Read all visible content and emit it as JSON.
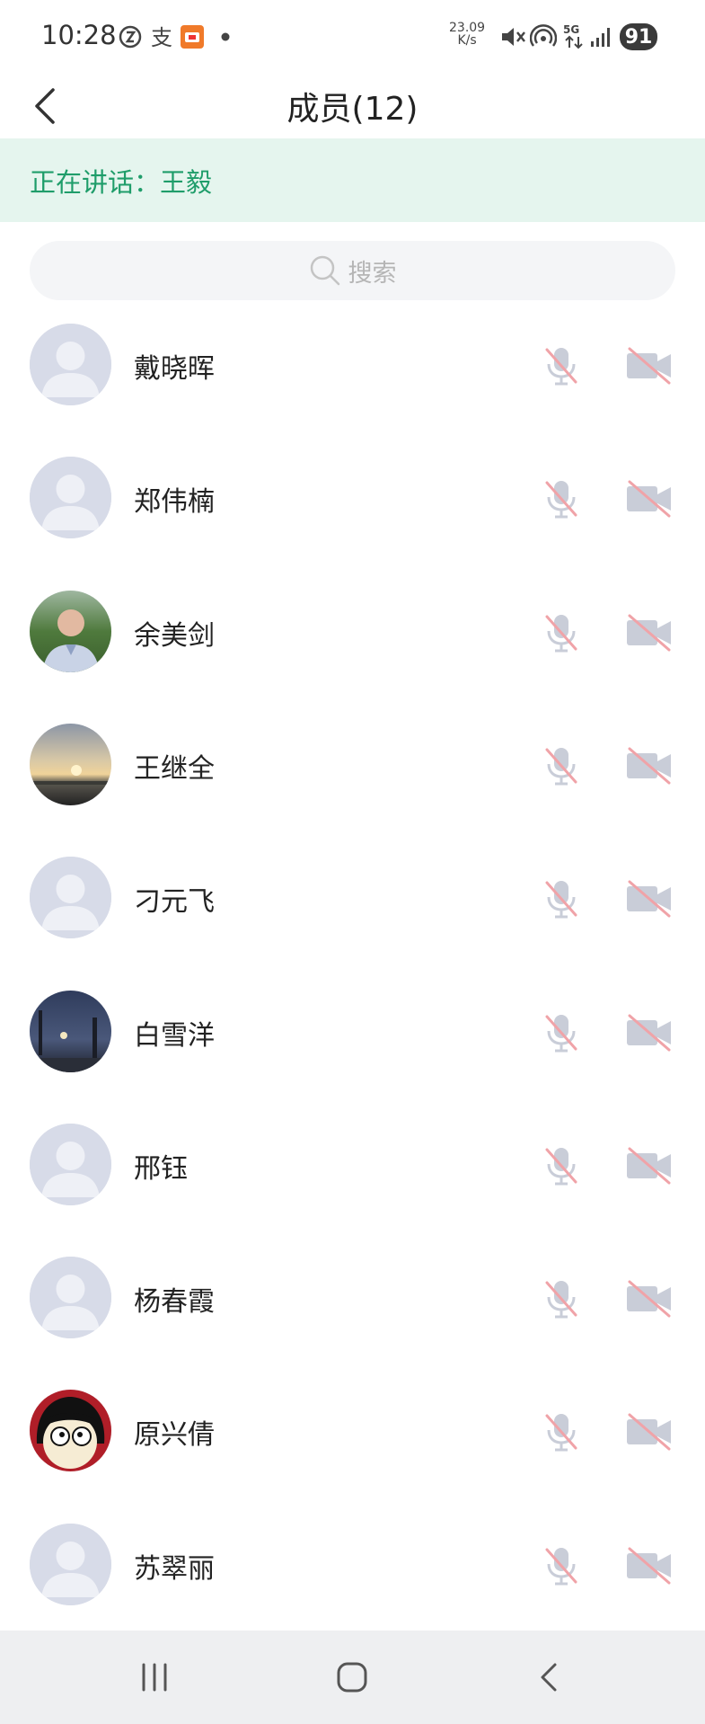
{
  "status": {
    "time": "10:28",
    "net_speed_value": "23.09",
    "net_speed_unit": "K/s",
    "network": "5G",
    "battery": "91"
  },
  "header": {
    "title": "成员(12)"
  },
  "speaking": {
    "label": "正在讲话：",
    "name": "王毅"
  },
  "search": {
    "placeholder": "搜索"
  },
  "members": [
    {
      "name": "戴晓晖",
      "avatar": "default"
    },
    {
      "name": "郑伟楠",
      "avatar": "default"
    },
    {
      "name": "余美剑",
      "avatar": "photo-man"
    },
    {
      "name": "王继全",
      "avatar": "photo-sunset"
    },
    {
      "name": "刁元飞",
      "avatar": "default"
    },
    {
      "name": "白雪洋",
      "avatar": "photo-night"
    },
    {
      "name": "邢钰",
      "avatar": "default"
    },
    {
      "name": "杨春霞",
      "avatar": "default"
    },
    {
      "name": "原兴倩",
      "avatar": "photo-cartoon"
    },
    {
      "name": "苏翠丽",
      "avatar": "default"
    }
  ],
  "colors": {
    "accent": "#1f9d6a",
    "speaking_bg": "#e5f5ee",
    "muted_icon": "#c9cdd8",
    "strike": "#f0a3a8"
  }
}
